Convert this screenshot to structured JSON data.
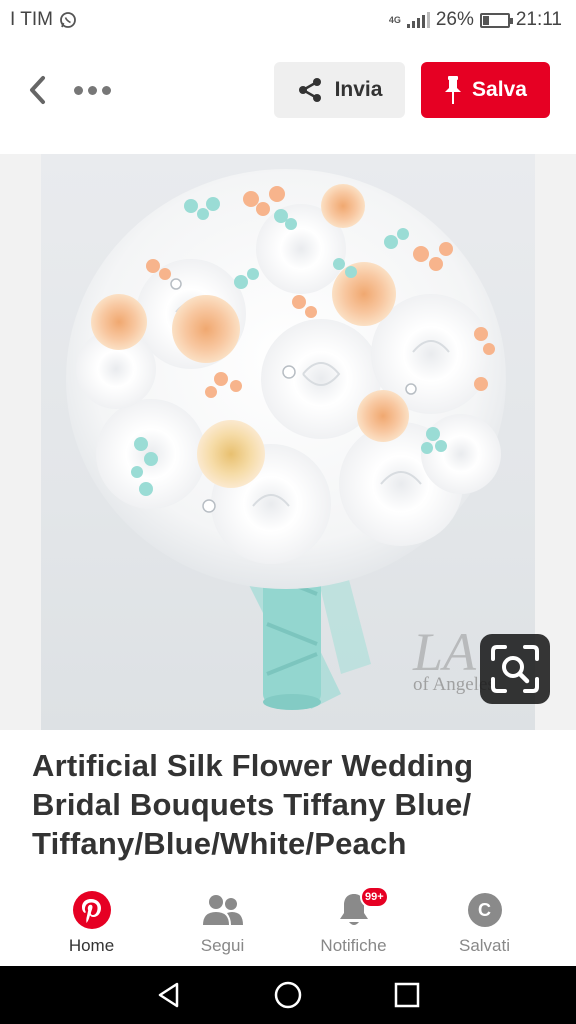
{
  "status_bar": {
    "carrier": "I TIM",
    "network": "4G",
    "battery": "26%",
    "battery_level": 0.26,
    "time": "21:11"
  },
  "toolbar": {
    "share_label": "Invia",
    "save_label": "Salva"
  },
  "pin": {
    "watermark_mark": "LA",
    "watermark_text": "of Angeles",
    "title": "Artificial Silk Flower Wedding Bridal Bouquets Tiffany Blue/ Tiffany/Blue/White/Peach"
  },
  "bottom_nav": {
    "items": [
      {
        "label": "Home",
        "icon": "pinterest-logo-icon",
        "active": true
      },
      {
        "label": "Segui",
        "icon": "people-icon"
      },
      {
        "label": "Notifiche",
        "icon": "bell-icon",
        "badge": "99+"
      },
      {
        "label": "Salvati",
        "icon": "avatar-icon",
        "avatar_initial": "C"
      }
    ]
  },
  "colors": {
    "brand_red": "#e60023",
    "tiffany_blue": "#8fd6cf",
    "peach": "#f5b98e"
  }
}
